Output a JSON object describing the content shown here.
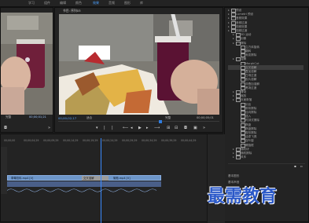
{
  "menu": [
    "学习",
    "组件",
    "编辑",
    "颜色",
    "效果",
    "音频",
    "图形",
    "库"
  ],
  "menu_active_index": 4,
  "source_monitor": {
    "tab_label": "节目: 草莓饮料",
    "timecode_left": "00;00;01;21",
    "timecode_right": "00;00;01;21",
    "fit_label": "完整"
  },
  "program_monitor": {
    "tab_label": "节目: 序列03",
    "timecode_current": "00;00;02;17",
    "fit_label": "适合",
    "quality": "完整",
    "timecode_end": "00;00;05;01"
  },
  "timeline": {
    "ruler_labels": [
      "00;00;00",
      "00;00;04;29",
      "00;00;09;29",
      "00;00;14;29",
      "00;00;19;29",
      "00;00;24;29",
      "00;00;29;29",
      "00;00;34;29",
      "00;00;39;29",
      "00;00;44;29"
    ],
    "clip_a": "草莓饮料.mp4 [V]",
    "clip_b": "交叉溶解",
    "clip_c": "葡萄.mp4 [V]"
  },
  "effects_tree": {
    "items": [
      {
        "label": "预设",
        "level": 0
      },
      {
        "label": "Lumetri 预设",
        "level": 0
      },
      {
        "label": "音频效果",
        "level": 0
      },
      {
        "label": "音频过渡",
        "level": 0
      },
      {
        "label": "视频效果",
        "level": 0
      },
      {
        "label": "视频过渡",
        "level": 0
      },
      {
        "label": "3D 运动",
        "level": 1
      },
      {
        "label": "划像",
        "level": 1
      },
      {
        "label": "擦除",
        "level": 1
      },
      {
        "label": "立方体旋转",
        "level": 2
      },
      {
        "label": "翻转",
        "level": 2
      },
      {
        "label": "渐变擦除",
        "level": 2
      },
      {
        "label": "溶解",
        "level": 1
      },
      {
        "label": "MorphCut",
        "level": 2
      },
      {
        "label": "交叉溶解",
        "level": 2
      },
      {
        "label": "叠加溶解",
        "level": 2
      },
      {
        "label": "白场过渡",
        "level": 2
      },
      {
        "label": "胶片溶解",
        "level": 2
      },
      {
        "label": "非叠加溶解",
        "level": 2
      },
      {
        "label": "黑场过渡",
        "level": 2
      },
      {
        "label": "滑动",
        "level": 1
      },
      {
        "label": "缩放",
        "level": 1
      },
      {
        "label": "页面剥落",
        "level": 1
      },
      {
        "label": "划出",
        "level": 2
      },
      {
        "label": "带状擦除",
        "level": 2
      },
      {
        "label": "径向擦除",
        "level": 2
      },
      {
        "label": "插入",
        "level": 2
      },
      {
        "label": "时钟式擦除",
        "level": 2
      },
      {
        "label": "棋盘",
        "level": 2
      },
      {
        "label": "棋盘擦除",
        "level": 2
      },
      {
        "label": "楔形擦除",
        "level": 2
      },
      {
        "label": "油漆飞溅",
        "level": 2
      },
      {
        "label": "百叶窗",
        "level": 2
      },
      {
        "label": "螺旋框",
        "level": 2
      },
      {
        "label": "随机块",
        "level": 1
      },
      {
        "label": "随机擦除",
        "level": 1
      },
      {
        "label": "风车",
        "level": 1
      }
    ],
    "selected_index": 14,
    "panel_a": "基本图形",
    "panel_b": "基本声音"
  },
  "watermark": "最需教育"
}
